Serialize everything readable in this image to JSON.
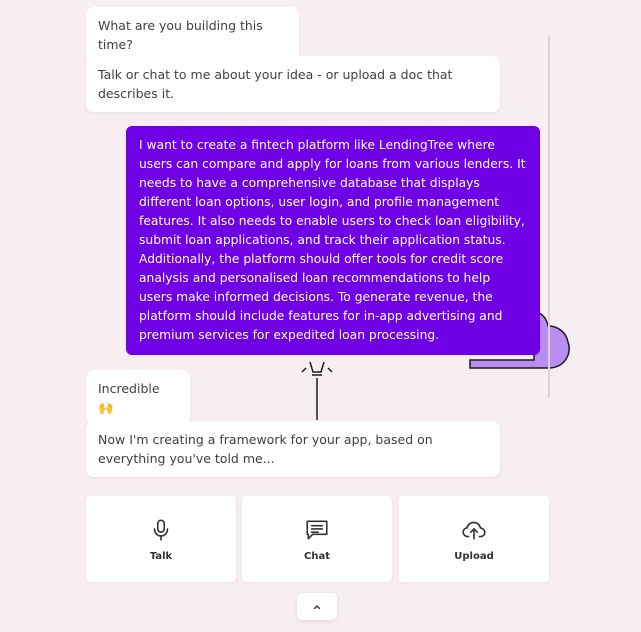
{
  "chat": {
    "messages": [
      {
        "role": "assistant",
        "text": "What are you building this time?"
      },
      {
        "role": "assistant",
        "text": "Talk or chat to me about your idea - or upload a doc that describes it."
      },
      {
        "role": "user",
        "text": "I want to create a fintech platform like LendingTree where users can compare and apply for loans from various lenders. It needs to have a comprehensive database that displays different loan options, user login, and profile management features. It also needs to enable users to check loan eligibility, submit loan applications, and track their application status. Additionally, the platform should offer tools for credit score analysis and personalised loan recommendations to help users make informed decisions. To generate revenue, the platform should include features for in-app advertising and premium services for expedited loan processing."
      },
      {
        "role": "assistant",
        "text": "Incredible 🙌"
      },
      {
        "role": "assistant",
        "text": "Now I'm creating a framework for your app, based on everything you've told me..."
      }
    ]
  },
  "actions": [
    {
      "label": "Talk",
      "icon": "microphone-icon"
    },
    {
      "label": "Chat",
      "icon": "chat-icon"
    },
    {
      "label": "Upload",
      "icon": "cloud-upload-icon"
    }
  ],
  "collapse": {
    "icon": "chevron-up-icon"
  },
  "colors": {
    "background": "#f7eef2",
    "user_bubble": "#6f00e6",
    "illustration_fill": "#b98cf2"
  }
}
